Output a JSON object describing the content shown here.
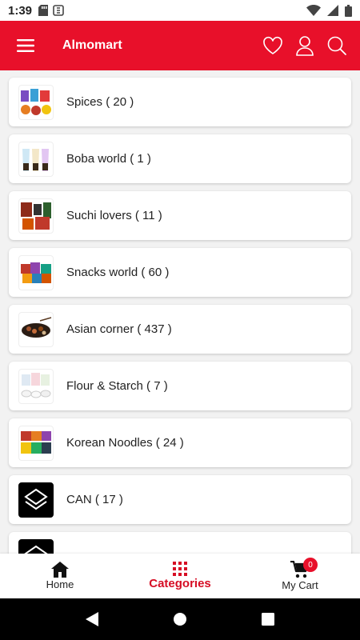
{
  "status": {
    "time": "1:39"
  },
  "appbar": {
    "title": "Almomart"
  },
  "categories": [
    {
      "label": "Spices ( 20 )"
    },
    {
      "label": "Boba world ( 1 )"
    },
    {
      "label": "Suchi lovers ( 11 )"
    },
    {
      "label": "Snacks world ( 60 )"
    },
    {
      "label": "Asian corner ( 437 )"
    },
    {
      "label": "Flour & Starch ( 7 )"
    },
    {
      "label": "Korean Noodles ( 24 )"
    },
    {
      "label": "CAN ( 17 )"
    }
  ],
  "bottom_nav": {
    "home": "Home",
    "categories": "Categories",
    "cart": "My Cart",
    "cart_count": "0"
  },
  "colors": {
    "brand": "#e8102a",
    "active": "#d60d24"
  }
}
